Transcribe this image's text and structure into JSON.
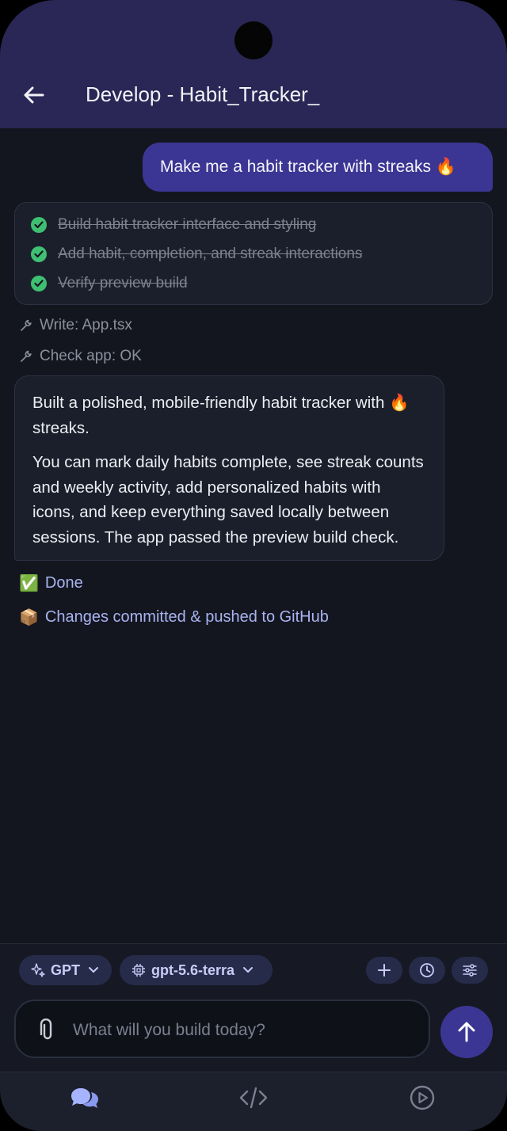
{
  "header": {
    "title": "Develop - Habit_Tracker_"
  },
  "chat": {
    "user_message": "Make me a habit tracker with streaks 🔥",
    "todos": [
      {
        "label": "Build habit tracker interface and styling",
        "done": true
      },
      {
        "label": "Add habit, completion, and streak interactions",
        "done": true
      },
      {
        "label": "Verify preview build",
        "done": true
      }
    ],
    "tool_calls": [
      {
        "label": "Write: App.tsx"
      },
      {
        "label": "Check app: OK"
      }
    ],
    "assistant_paragraphs": [
      "Built a polished, mobile-friendly habit tracker with 🔥 streaks.",
      "You can mark daily habits complete, see streak counts and weekly activity, add personalized habits with icons, and keep everything saved locally between sessions. The app passed the preview build check."
    ],
    "status_done": {
      "emoji": "✅",
      "text": "Done"
    },
    "status_commit": {
      "emoji": "📦",
      "text": "Changes committed & pushed to GitHub"
    }
  },
  "toolbar": {
    "provider": "GPT",
    "model": "gpt-5.6-terra"
  },
  "composer": {
    "placeholder": "What will you build today?",
    "value": ""
  },
  "colors": {
    "header_bg": "#2a2655",
    "accent": "#3b3693",
    "check_green": "#3fbf72",
    "status_link": "#a9b3f0",
    "background": "#14161f"
  },
  "icons": {
    "back": "arrow-left-icon",
    "check": "check-circle-icon",
    "tool": "wrench-icon",
    "provider": "sparkles-icon",
    "model": "chip-icon",
    "add": "plus-icon",
    "history": "clock-icon",
    "settings": "sliders-icon",
    "attach": "paperclip-icon",
    "send": "arrow-up-icon",
    "nav_chat": "chat-bubbles-icon",
    "nav_code": "code-icon",
    "nav_preview": "play-circle-icon"
  }
}
